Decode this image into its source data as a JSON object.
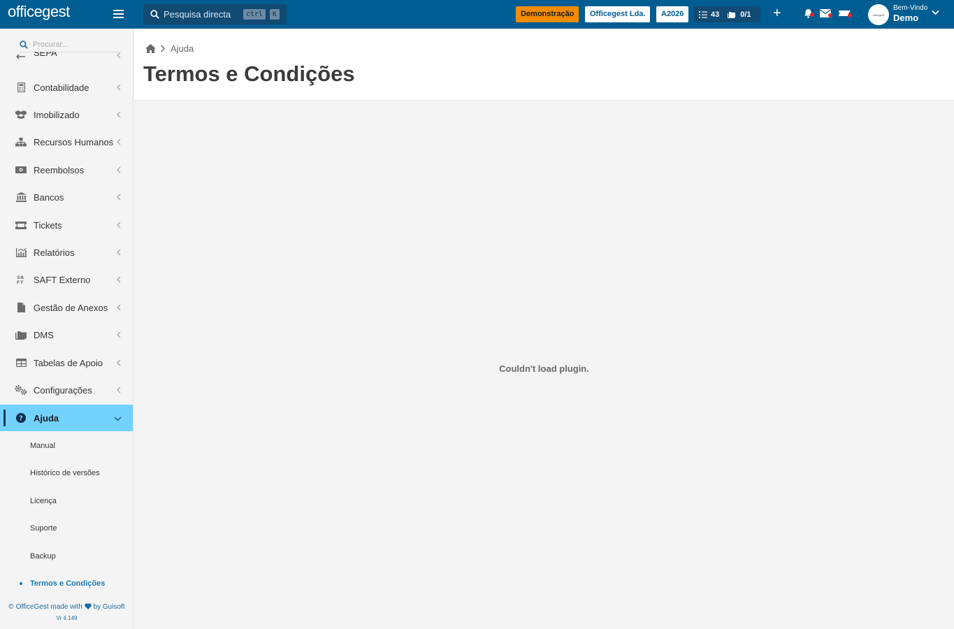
{
  "topbar": {
    "logo_text": "officegest",
    "search_placeholder": "Pesquisa directa",
    "shortcut_ctrl": "ctrl",
    "shortcut_k": "K",
    "mode_badge": "Demonstração",
    "company_badge": "Officegest Lda.",
    "year_badge": "A2026",
    "tasks_count": "43",
    "docs_count": "0/1",
    "welcome_label": "Bem-Vindo",
    "user_name": "Demo",
    "avatar_text": "officegest",
    "accent_color": "#005d92",
    "demo_color": "#f28c00",
    "alert_color": "#e0262d"
  },
  "sidebar": {
    "search_placeholder": "Procurar...",
    "items": [
      {
        "label": "SEPA",
        "icon": "sepa-icon"
      },
      {
        "label": "Contabilidade",
        "icon": "calculator-icon"
      },
      {
        "label": "Imobilizado",
        "icon": "boxes-icon"
      },
      {
        "label": "Recursos Humanos",
        "icon": "sitemap-icon"
      },
      {
        "label": "Reembolsos",
        "icon": "money-icon"
      },
      {
        "label": "Bancos",
        "icon": "bank-icon"
      },
      {
        "label": "Tickets",
        "icon": "ticket-icon"
      },
      {
        "label": "Relatórios",
        "icon": "chart-icon"
      },
      {
        "label": "SAFT Externo",
        "icon": "saft-icon"
      },
      {
        "label": "Gestão de Anexos",
        "icon": "file-icon"
      },
      {
        "label": "DMS",
        "icon": "folder-icon"
      },
      {
        "label": "Tabelas de Apoio",
        "icon": "table-icon"
      },
      {
        "label": "Configurações",
        "icon": "cogs-icon"
      },
      {
        "label": "Ajuda",
        "icon": "help-icon"
      }
    ],
    "active_color": "#73d2fd",
    "subitems": [
      {
        "label": "Manual"
      },
      {
        "label": "Histórico de versões"
      },
      {
        "label": "Licença"
      },
      {
        "label": "Suporte"
      },
      {
        "label": "Backup"
      },
      {
        "label": "Termos e Condições"
      }
    ],
    "footer_line1_a": "© OfficeGest made with",
    "footer_line1_b": "by Guisoft",
    "footer_version": "Vr 4.149"
  },
  "main": {
    "breadcrumb": "Ajuda",
    "title": "Termos e Condições",
    "plugin_message": "Couldn't load plugin."
  }
}
